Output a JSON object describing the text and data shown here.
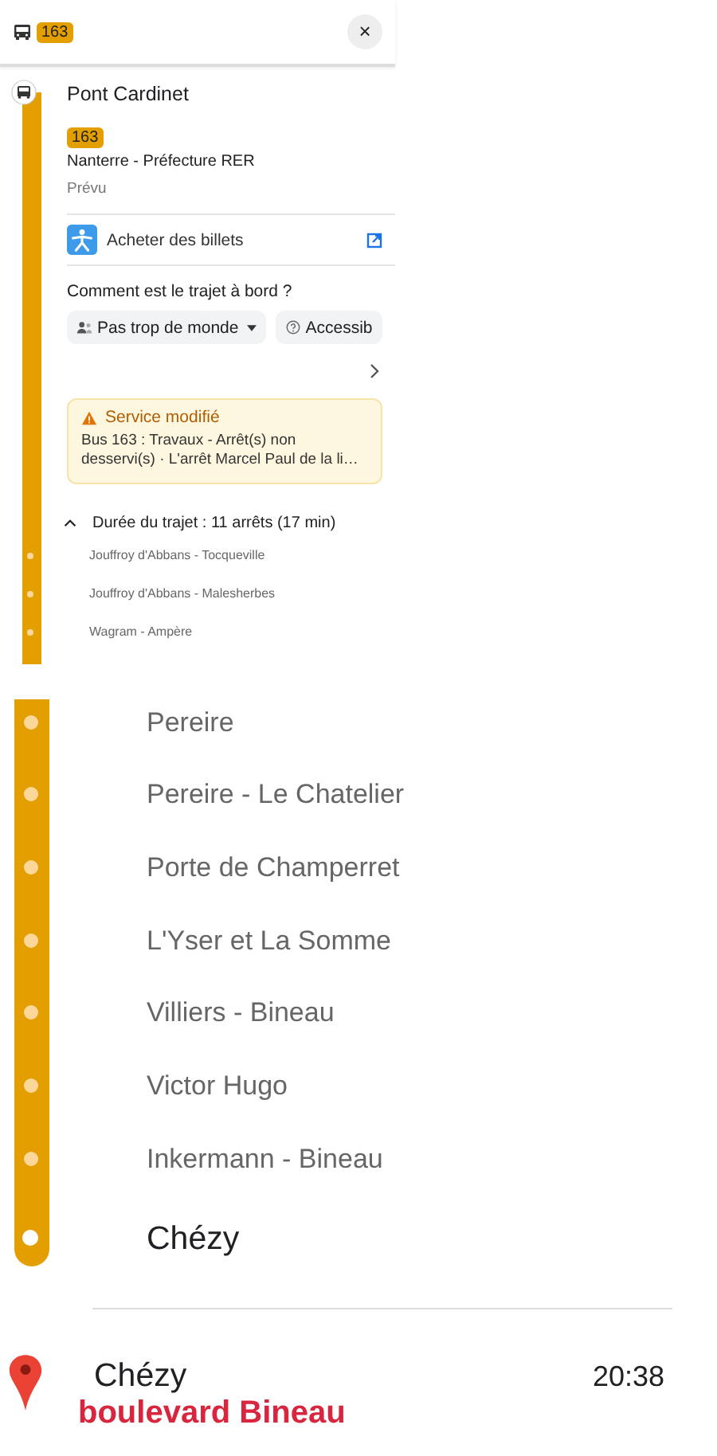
{
  "header": {
    "route_badge": "163",
    "close": "×"
  },
  "origin": {
    "name": "Pont Cardinet",
    "route_badge": "163",
    "direction": "Nanterre - Préfecture RER",
    "status": "Prévu"
  },
  "tickets": {
    "label": "Acheter des billets"
  },
  "crowding": {
    "question": "Comment est le trajet à bord ?",
    "chips": [
      {
        "label": "Pas trop de monde",
        "kind": "dropdown"
      },
      {
        "label": "Accessib",
        "kind": "help"
      }
    ]
  },
  "alert": {
    "title": "Service modifié",
    "text": "Bus 163 : Travaux - Arrêt(s) non desservi(s) · L'arrêt Marcel Paul de la li…"
  },
  "trip": {
    "summary": "Durée du trajet : 11 arrêts (17 min)",
    "expanded": true,
    "stops": [
      "Jouffroy d'Abbans - Tocqueville",
      "Jouffroy d'Abbans - Malesherbes",
      "Wagram - Ampère"
    ]
  },
  "stops_large": [
    "Pereire",
    "Pereire - Le Chatelier",
    "Porte de Champerret",
    "L'Yser et La Somme",
    "Villiers - Bineau",
    "Victor Hugo",
    "Inkermann - Bineau"
  ],
  "final_stop": "Chézy",
  "destination": {
    "name": "Chézy",
    "time": "20:38",
    "street": "boulevard Bineau"
  }
}
